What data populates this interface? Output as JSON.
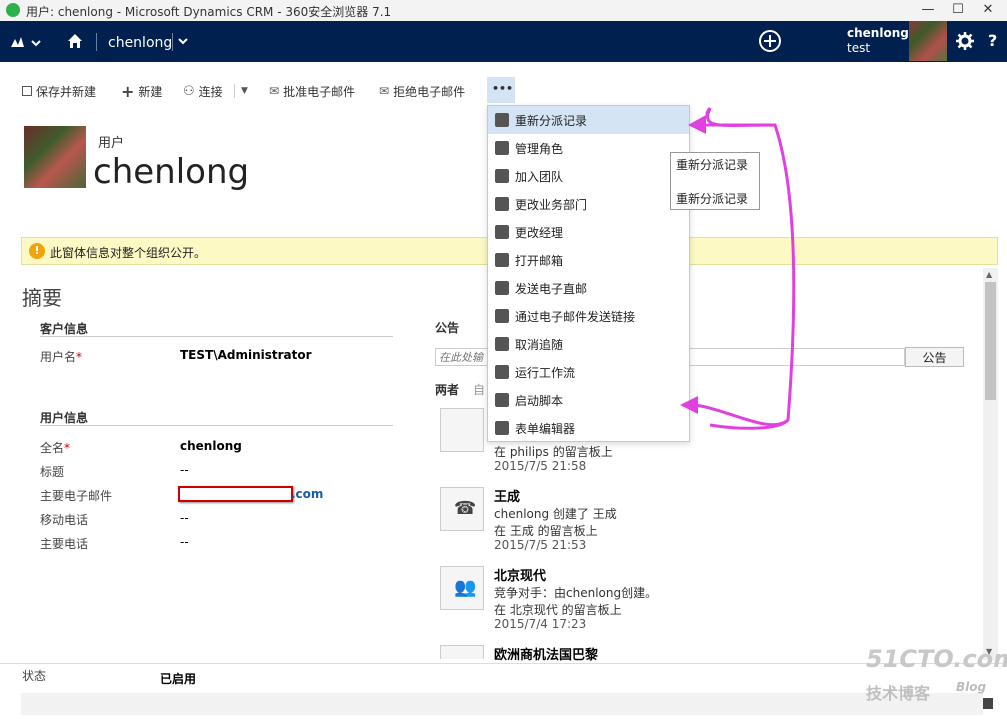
{
  "window": {
    "title": "用户: chenlong - Microsoft Dynamics CRM - 360安全浏览器 7.1",
    "minimize": "—",
    "maximize": "☐",
    "close": "✕"
  },
  "nav": {
    "entity": "chenlong",
    "user_name": "chenlong",
    "user_org": "test"
  },
  "commands": {
    "save_new": "保存并新建",
    "new": "新建",
    "connect": "连接",
    "approve_email": "批准电子邮件",
    "reject_email": "拒绝电子邮件",
    "more": "•••"
  },
  "menu": [
    {
      "label": "重新分派记录",
      "icon": "reassign-icon"
    },
    {
      "label": "管理角色",
      "icon": "roles-icon"
    },
    {
      "label": "加入团队",
      "icon": "team-icon"
    },
    {
      "label": "更改业务部门",
      "icon": "business-unit-icon"
    },
    {
      "label": "更改经理",
      "icon": "manager-icon"
    },
    {
      "label": "打开邮箱",
      "icon": "mailbox-icon"
    },
    {
      "label": "发送电子直邮",
      "icon": "direct-email-icon"
    },
    {
      "label": "通过电子邮件发送链接",
      "icon": "link-icon"
    },
    {
      "label": "取消追随",
      "icon": "star-icon"
    },
    {
      "label": "运行工作流",
      "icon": "workflow-icon"
    },
    {
      "label": "启动脚本",
      "icon": "script-icon"
    },
    {
      "label": "表单编辑器",
      "icon": "form-editor-icon"
    }
  ],
  "tooltip": {
    "line1": "重新分派记录",
    "line2": "重新分派记录"
  },
  "record": {
    "type": "用户",
    "name": "chenlong"
  },
  "notification": "此窗体信息对整个组织公开。",
  "summary": {
    "title": "摘要",
    "client_section": "客户信息",
    "username_label": "用户名",
    "username_value": "TEST\\Administrator",
    "user_section": "用户信息",
    "fullname_label": "全名",
    "fullname_value": "chenlong",
    "title_label": "标题",
    "title_value": "--",
    "email_label": "主要电子邮件",
    "email_value": ".com",
    "mobile_label": "移动电话",
    "mobile_value": "--",
    "phone_label": "主要电话",
    "phone_value": "--"
  },
  "posts": {
    "title": "公告",
    "placeholder": "在此处输",
    "post_button": "公告",
    "filter_both": "两者",
    "filter_auto": "自",
    "items": [
      {
        "title": "",
        "line1": "",
        "line2": "在 philips 的留言板上",
        "date": "2015/7/5 21:58"
      },
      {
        "title": "王成",
        "line1": "chenlong 创建了 王成",
        "line2": "在 王成 的留言板上",
        "date": "2015/7/5 21:53"
      },
      {
        "title": "北京现代",
        "line1": "竞争对手：由chenlong创建。",
        "line2": "在 北京现代 的留言板上",
        "date": "2015/7/4 17:23"
      },
      {
        "title": "欧洲商机法国巴黎",
        "line1": "",
        "line2": "",
        "date": ""
      }
    ]
  },
  "footer": {
    "status_label": "状态",
    "status_value": "已启用"
  },
  "watermark": {
    "site": "51CTO.com",
    "text": "技术博客",
    "blog": "Blog"
  },
  "colors": {
    "nav_bg": "#002050",
    "notif_bg": "#fcf9c4",
    "menu_selected": "#d4e4f5",
    "annotation_arrow": "#e040e0",
    "redaction": "#d00000"
  }
}
